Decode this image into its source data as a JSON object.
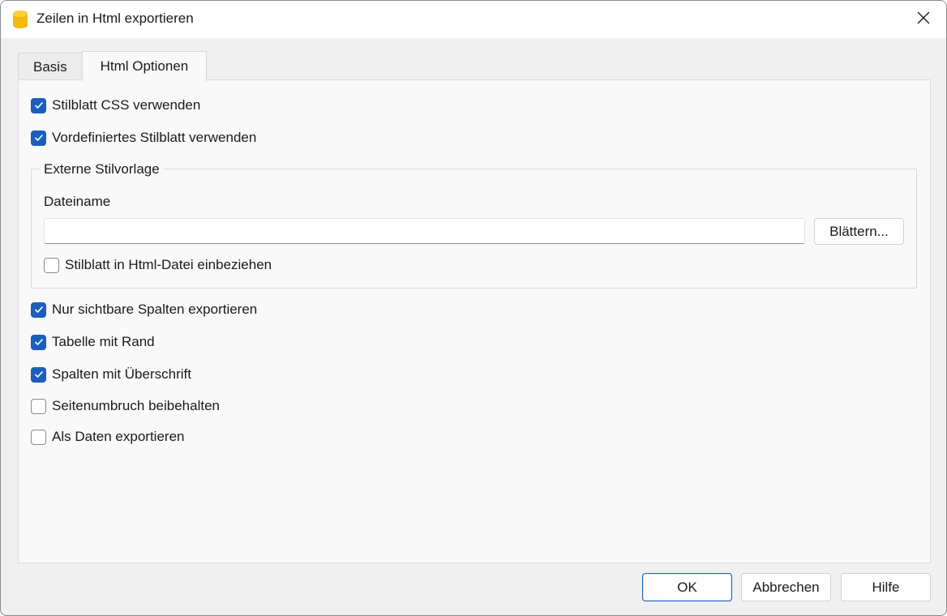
{
  "window": {
    "title": "Zeilen in Html exportieren",
    "close_icon": "close-icon",
    "app_icon": "database-icon",
    "app_icon_color": "#f5b80d"
  },
  "tabs": [
    {
      "label": "Basis",
      "active": false
    },
    {
      "label": "Html Optionen",
      "active": true
    }
  ],
  "options_top": [
    {
      "label": "Stilblatt CSS verwenden",
      "checked": true
    },
    {
      "label": "Vordefiniertes Stilblatt verwenden",
      "checked": true
    }
  ],
  "external_style": {
    "legend": "Externe Stilvorlage",
    "filename_label": "Dateiname",
    "filename_value": "",
    "browse_label": "Blättern...",
    "include_option": {
      "label": "Stilblatt in Html-Datei einbeziehen",
      "checked": false
    }
  },
  "options_bottom": [
    {
      "label": "Nur sichtbare Spalten exportieren",
      "checked": true
    },
    {
      "label": "Tabelle mit Rand",
      "checked": true
    },
    {
      "label": "Spalten mit Überschrift",
      "checked": true
    },
    {
      "label": "Seitenumbruch beibehalten",
      "checked": false
    },
    {
      "label": "Als Daten exportieren",
      "checked": false
    }
  ],
  "buttons": {
    "ok": "OK",
    "cancel": "Abbrechen",
    "help": "Hilfe"
  },
  "colors": {
    "accent": "#1b5ebe",
    "window_bg": "#f0f0f0",
    "panel_bg": "#f9f9f9"
  }
}
